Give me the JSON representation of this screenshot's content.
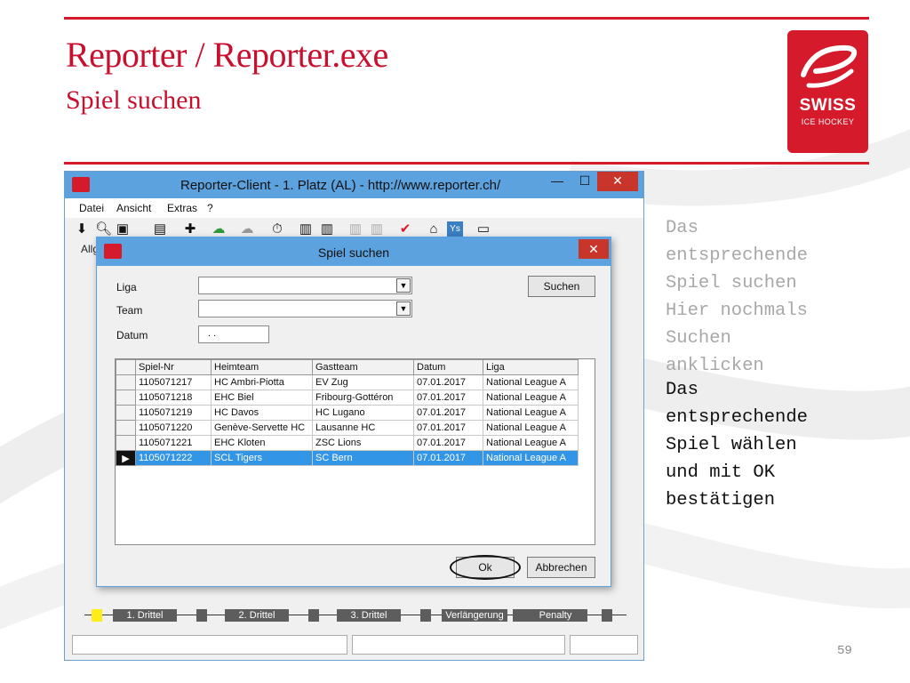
{
  "slide": {
    "title": "Reporter / Reporter.exe",
    "subtitle": "Spiel suchen",
    "page_number": "59",
    "brand_color": "#d51a2b"
  },
  "logo": {
    "line1": "SWISS",
    "line2": "ICE HOCKEY"
  },
  "notes": {
    "gray": "Das\nentsprechende\nSpiel suchen\nHier nochmals\nSuchen\nanklicken",
    "black": "Das\nentsprechende\nSpiel wählen\nund mit OK\nbestätigen"
  },
  "window": {
    "title": "Reporter-Client  -  1. Platz (AL)  -  http://www.reporter.ch/",
    "controls": {
      "minimize": "—",
      "maximize": "☐",
      "close": "✕"
    },
    "menu": [
      "Datei",
      "Ansicht",
      "Extras",
      "?"
    ],
    "toolbar_icons": [
      "download-icon",
      "search-icon",
      "save-icon",
      "clipboard-icon",
      "players-icon",
      "upload-cloud-icon",
      "cloud-disabled-icon",
      "stopwatch-icon",
      "lineup-icon",
      "lineup-icon-2",
      "lineup-disabled-icon",
      "lineup-disabled-icon-2",
      "checkmark-icon",
      "home-icon",
      "ys-icon",
      "tv-icon"
    ],
    "tab_label": "Allg",
    "period_bar": [
      "1. Drittel",
      "2. Drittel",
      "3. Drittel",
      "Verlängerung",
      "Penalty"
    ]
  },
  "dialog": {
    "title": "Spiel suchen",
    "close": "✕",
    "labels": {
      "liga": "Liga",
      "team": "Team",
      "datum": "Datum"
    },
    "date_value": ". .",
    "buttons": {
      "suchen": "Suchen",
      "ok": "Ok",
      "abbrechen": "Abbrechen"
    },
    "table": {
      "columns": [
        "Spiel-Nr",
        "Heimteam",
        "Gastteam",
        "Datum",
        "Liga"
      ],
      "rows": [
        [
          "1105071217",
          "HC Ambri-Piotta",
          "EV Zug",
          "07.01.2017",
          "National League A"
        ],
        [
          "1105071218",
          "EHC Biel",
          "Fribourg-Gottéron",
          "07.01.2017",
          "National League A"
        ],
        [
          "1105071219",
          "HC Davos",
          "HC Lugano",
          "07.01.2017",
          "National League A"
        ],
        [
          "1105071220",
          "Genève-Servette HC",
          "Lausanne HC",
          "07.01.2017",
          "National League A"
        ],
        [
          "1105071221",
          "EHC Kloten",
          "ZSC Lions",
          "07.01.2017",
          "National League A"
        ],
        [
          "1105071222",
          "SCL Tigers",
          "SC Bern",
          "07.01.2017",
          "National League A"
        ]
      ],
      "selected_row": 5,
      "selection_color": "#3295e6"
    }
  }
}
